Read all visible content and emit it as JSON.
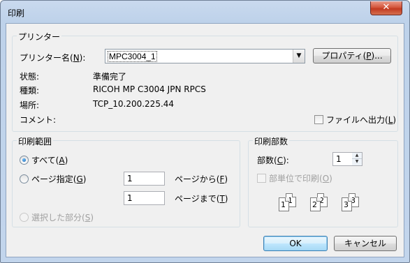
{
  "window": {
    "title": "印刷",
    "close_glyph": "✕"
  },
  "printer_group": {
    "legend": "プリンター",
    "name_label_pre": "プリンター名(",
    "name_label_key": "N",
    "name_label_post": "):",
    "selected_printer": "MPC3004_1",
    "properties_pre": "プロパティ(",
    "properties_key": "P",
    "properties_post": ")...",
    "status_label": "状態:",
    "status_value": "準備完了",
    "type_label": "種類:",
    "type_value": "RICOH MP C3004 JPN RPCS",
    "location_label": "場所:",
    "location_value": "TCP_10.200.225.44",
    "comment_label": "コメント:",
    "print_to_file_pre": "ファイルへ出力(",
    "print_to_file_key": "L",
    "print_to_file_post": ")",
    "print_to_file_checked": false
  },
  "range_group": {
    "legend": "印刷範囲",
    "all_pre": "すべて(",
    "all_key": "A",
    "all_post": ")",
    "all_selected": true,
    "pages_pre": "ページ指定(",
    "pages_key": "G",
    "pages_post": ")",
    "from_value": "1",
    "from_label_pre": "ページから(",
    "from_label_key": "F",
    "from_label_post": ")",
    "to_value": "1",
    "to_label_pre": "ページまで(",
    "to_label_key": "T",
    "to_label_post": ")",
    "selection_pre": "選択した部分(",
    "selection_key": "S",
    "selection_post": ")"
  },
  "copies_group": {
    "legend": "印刷部数",
    "copies_label_pre": "部数(",
    "copies_label_key": "C",
    "copies_label_post": "):",
    "copies_value": "1",
    "collate_pre": "部単位で印刷(",
    "collate_key": "O",
    "collate_post": ")",
    "collate_checked": false,
    "collate_pages": [
      "1",
      "1",
      "2",
      "2",
      "3",
      "3"
    ]
  },
  "buttons": {
    "ok": "OK",
    "cancel": "キャンセル"
  },
  "icons": {
    "dropdown": "chevron-down-icon",
    "spin_up": "▲",
    "spin_down": "▼",
    "combo_arrow": "▼"
  },
  "colors": {
    "title_bg": "#c4d7ee",
    "client_bg": "#f0f0f0",
    "close_red": "#c8472b",
    "default_button": "#a7d9f5"
  }
}
